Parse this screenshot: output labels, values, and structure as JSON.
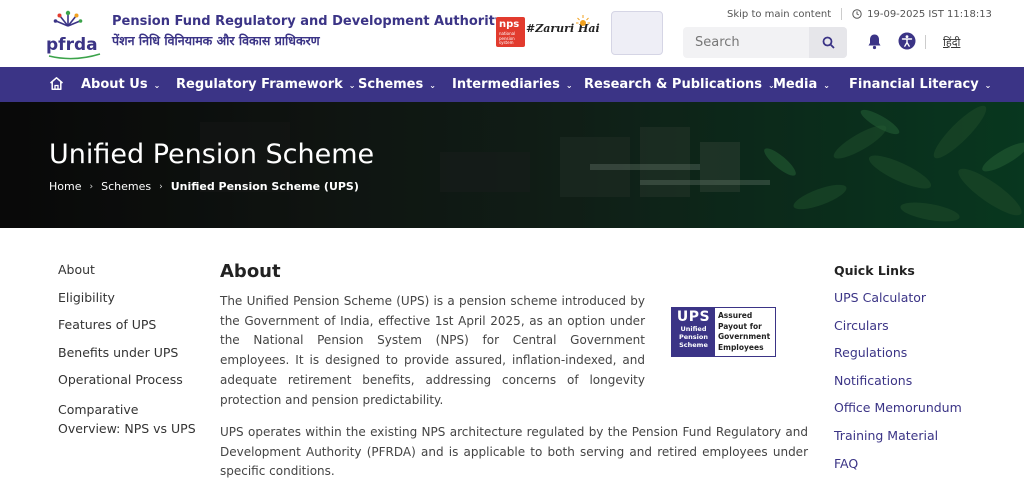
{
  "header": {
    "org_name_en": "Pension Fund Regulatory and Development Authority",
    "org_name_hi": "पेंशन निधि विनियामक और विकास प्राधिकरण",
    "logo_text": "pfrda",
    "nps_badge": "nps",
    "nps_badge_sub": "national pension system",
    "campaign": "#Zaruri Hai",
    "skip_link": "Skip to main content",
    "datetime": "19-09-2025 IST 11:18:13",
    "search_placeholder": "Search",
    "language_toggle": "हिंदी",
    "icons": [
      "search-icon",
      "bell-icon",
      "accessibility-icon",
      "clock-icon",
      "home-icon"
    ]
  },
  "nav": {
    "items": [
      {
        "label": "About Us"
      },
      {
        "label": "Regulatory Framework"
      },
      {
        "label": "Schemes"
      },
      {
        "label": "Intermediaries"
      },
      {
        "label": "Research & Publications"
      },
      {
        "label": "Media"
      },
      {
        "label": "Financial Literacy"
      }
    ]
  },
  "banner": {
    "title": "Unified Pension Scheme",
    "breadcrumb": [
      "Home",
      "Schemes",
      "Unified Pension Scheme (UPS)"
    ]
  },
  "left_nav": {
    "items": [
      "About",
      "Eligibility",
      "Features of UPS",
      "Benefits under UPS",
      "Operational Process",
      "Comparative Overview: NPS vs UPS"
    ]
  },
  "main": {
    "heading": "About",
    "paragraph1": "The Unified Pension Scheme (UPS) is a pension scheme introduced by the Government of India, effective 1st April 2025, as an option under the National Pension System (NPS) for Central Government employees. It is designed to provide assured, inflation-indexed, and adequate retirement benefits, addressing concerns of longevity protection and pension predictability.",
    "paragraph2": "UPS operates within the existing NPS architecture regulated by the Pension Fund Regulatory and Development Authority (PFRDA) and is applicable to both serving and retired employees under specific conditions.",
    "ups_logo": {
      "abbr": "UPS",
      "line1": "Unified",
      "line2": "Pension",
      "line3": "Scheme",
      "tag1": "Assured",
      "tag2": "Payout for",
      "tag3": "Government",
      "tag4": "Employees"
    }
  },
  "quick_links": {
    "title": "Quick Links",
    "items": [
      "UPS Calculator",
      "Circulars",
      "Regulations",
      "Notifications",
      "Office Memorundum",
      "Training Material",
      "FAQ"
    ]
  },
  "colors": {
    "brand": "#3b3486",
    "nav_bg": "#3b3486",
    "link": "#3b3486",
    "nps_red": "#e23b2e"
  }
}
